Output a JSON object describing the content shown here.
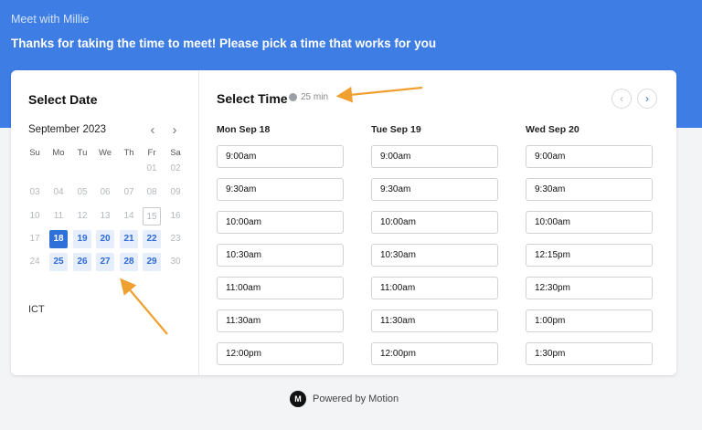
{
  "banner": {
    "subtitle": "Meet with Millie",
    "title": "Thanks for taking the time to meet! Please pick a time that works for you"
  },
  "date_panel": {
    "heading": "Select Date",
    "month": "September 2023",
    "weekdays": [
      "Su",
      "Mo",
      "Tu",
      "We",
      "Th",
      "Fr",
      "Sa"
    ],
    "weeks": [
      [
        "",
        "",
        "",
        "",
        "",
        "01",
        "02"
      ],
      [
        "03",
        "04",
        "05",
        "06",
        "07",
        "08",
        "09"
      ],
      [
        "10",
        "11",
        "12",
        "13",
        "14",
        "15",
        "16"
      ],
      [
        "17",
        "18",
        "19",
        "20",
        "21",
        "22",
        "23"
      ],
      [
        "24",
        "25",
        "26",
        "27",
        "28",
        "29",
        "30"
      ]
    ],
    "available_days": [
      "18",
      "19",
      "20",
      "21",
      "22",
      "25",
      "26",
      "27",
      "28",
      "29"
    ],
    "selected_day": "18",
    "today": "15",
    "timezone": "ICT"
  },
  "time_panel": {
    "heading": "Select Time",
    "duration": "25 min",
    "days": [
      {
        "label": "Mon Sep 18",
        "slots": [
          "9:00am",
          "9:30am",
          "10:00am",
          "10:30am",
          "11:00am",
          "11:30am",
          "12:00pm"
        ]
      },
      {
        "label": "Tue Sep 19",
        "slots": [
          "9:00am",
          "9:30am",
          "10:00am",
          "10:30am",
          "11:00am",
          "11:30am",
          "12:00pm"
        ]
      },
      {
        "label": "Wed Sep 20",
        "slots": [
          "9:00am",
          "9:30am",
          "10:00am",
          "12:15pm",
          "12:30pm",
          "1:00pm",
          "1:30pm"
        ]
      }
    ]
  },
  "footer": {
    "powered_by": "Powered by Motion"
  },
  "colors": {
    "banner": "#3d7de4",
    "accent": "#2f6fd8",
    "annotation_arrow": "#f0a030"
  }
}
